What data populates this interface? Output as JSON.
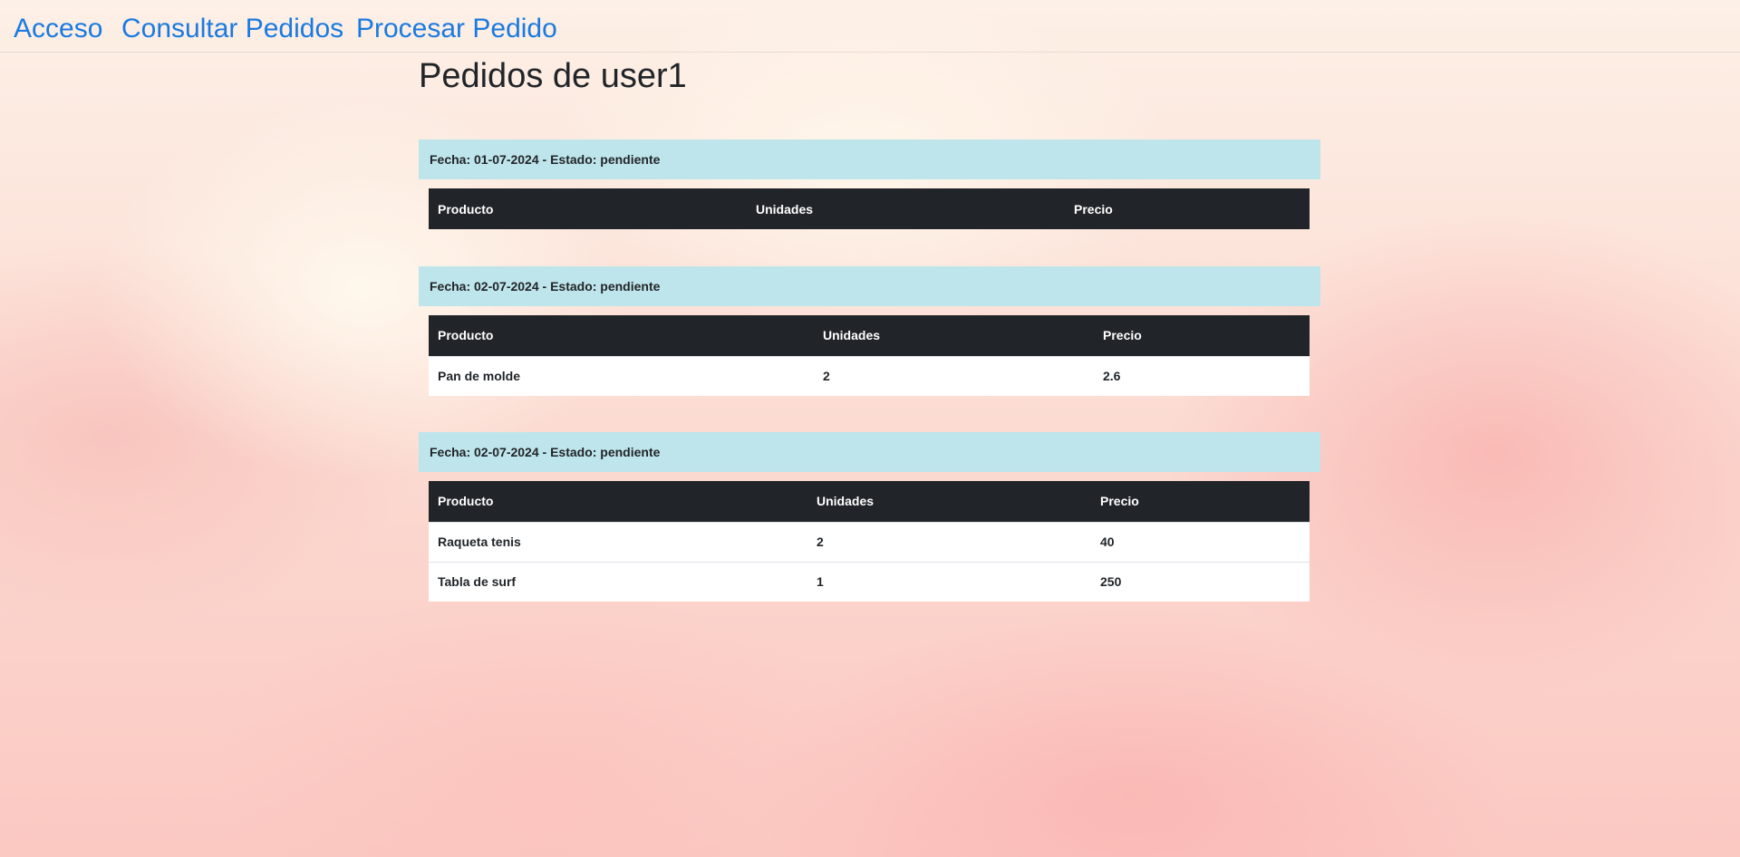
{
  "nav": {
    "links": [
      "Acceso",
      "Consultar Pedidos",
      "Procesar Pedido"
    ]
  },
  "page_title": "Pedidos de user1",
  "colors": {
    "nav_link": "#1a7ae0",
    "order_header_bg": "#bee5eb",
    "table_header_bg": "#212529",
    "table_row_bg": "#ffffff"
  },
  "orders": [
    {
      "header": "Fecha: 01-07-2024 - Estado: pendiente",
      "columns": [
        "Producto",
        "Unidades",
        "Precio"
      ],
      "rows": []
    },
    {
      "header": "Fecha: 02-07-2024 - Estado: pendiente",
      "columns": [
        "Producto",
        "Unidades",
        "Precio"
      ],
      "rows": [
        [
          "Pan de molde",
          "2",
          "2.6"
        ]
      ]
    },
    {
      "header": "Fecha: 02-07-2024 - Estado: pendiente",
      "columns": [
        "Producto",
        "Unidades",
        "Precio"
      ],
      "rows": [
        [
          "Raqueta tenis",
          "2",
          "40"
        ],
        [
          "Tabla de surf",
          "1",
          "250"
        ]
      ]
    }
  ]
}
